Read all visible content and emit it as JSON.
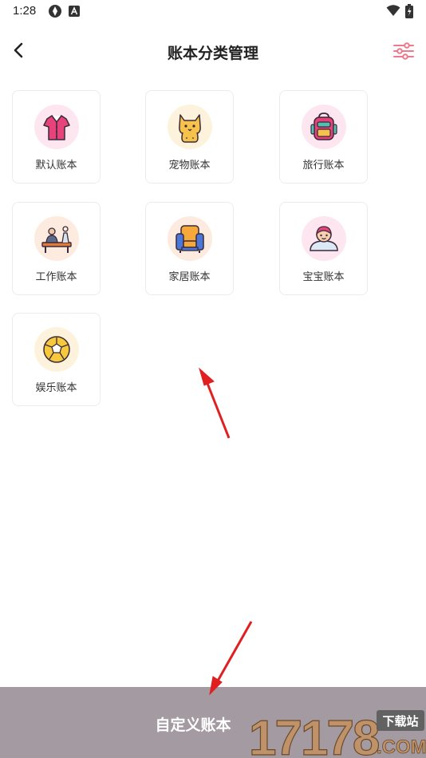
{
  "status_bar": {
    "time": "1:28",
    "icons": [
      "app-icon",
      "a-icon",
      "wifi-icon",
      "battery-icon"
    ]
  },
  "header": {
    "title": "账本分类管理",
    "back_icon": "chevron-left-icon",
    "settings_icon": "sliders-icon"
  },
  "categories": [
    {
      "label": "默认账本",
      "icon": "shirt-icon",
      "bg": "#fde6ef"
    },
    {
      "label": "宠物账本",
      "icon": "cat-icon",
      "bg": "#fdf3dc"
    },
    {
      "label": "旅行账本",
      "icon": "backpack-icon",
      "bg": "#fde6ef"
    },
    {
      "label": "工作账本",
      "icon": "desk-icon",
      "bg": "#fdebe0"
    },
    {
      "label": "家居账本",
      "icon": "armchair-icon",
      "bg": "#fdebe0"
    },
    {
      "label": "宝宝账本",
      "icon": "baby-icon",
      "bg": "#fde6ef"
    },
    {
      "label": "娱乐账本",
      "icon": "ball-icon",
      "bg": "#fdf3dc"
    }
  ],
  "bottom_bar": {
    "label": "自定义账本",
    "color": "#a39aa2"
  },
  "watermark": {
    "brand": "17178",
    "badge": "下载站",
    "suffix": ".COM"
  },
  "colors": {
    "accent": "#f0788c",
    "annotation_arrow": "#e02020"
  }
}
